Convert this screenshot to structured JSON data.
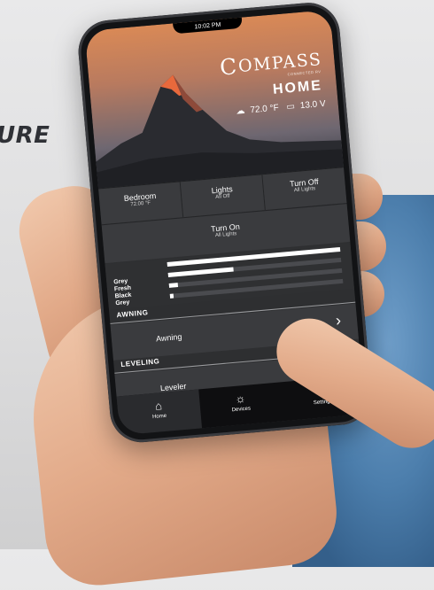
{
  "background": {
    "word_fragment": "URE"
  },
  "status_bar": {
    "time": "10:02 PM"
  },
  "hero": {
    "brand_mark": "C",
    "brand_text": "OMPASS",
    "brand_subtitle": "CONNECTED RV",
    "screen_title": "HOME",
    "temperature": "72.0 °F",
    "voltage": "13.0 V",
    "weather_icon": "partly-sunny-icon",
    "battery_icon": "battery-icon"
  },
  "tiles": [
    {
      "title": "Bedroom",
      "subtitle": "72.00 °F"
    },
    {
      "title": "Lights",
      "subtitle": "All Off"
    },
    {
      "title": "Turn Off",
      "subtitle": "All Lights"
    }
  ],
  "wide_tile": {
    "title": "Turn On",
    "subtitle": "All Lights"
  },
  "tanks": [
    {
      "label": "Grey",
      "level": 1.0
    },
    {
      "label": "Fresh",
      "level": 0.38
    },
    {
      "label": "Black",
      "level": 0.05
    },
    {
      "label": "Grey",
      "level": 0.02
    }
  ],
  "sections": {
    "awning": {
      "header": "AWNING",
      "row_label": "Awning",
      "chevron_icon": "chevron-right-icon"
    },
    "leveling": {
      "header": "LEVELING",
      "row_label": "Leveler"
    }
  },
  "nav": [
    {
      "label": "Home",
      "icon": "home-icon",
      "active": true
    },
    {
      "label": "Devices",
      "icon": "lightbulb-icon",
      "active": false
    },
    {
      "label": "Settings",
      "icon": "gear-icon",
      "active": false
    }
  ],
  "colors": {
    "accent": "#d98956",
    "panel": "#3a3b3e",
    "fabric": "#4c7eac"
  }
}
